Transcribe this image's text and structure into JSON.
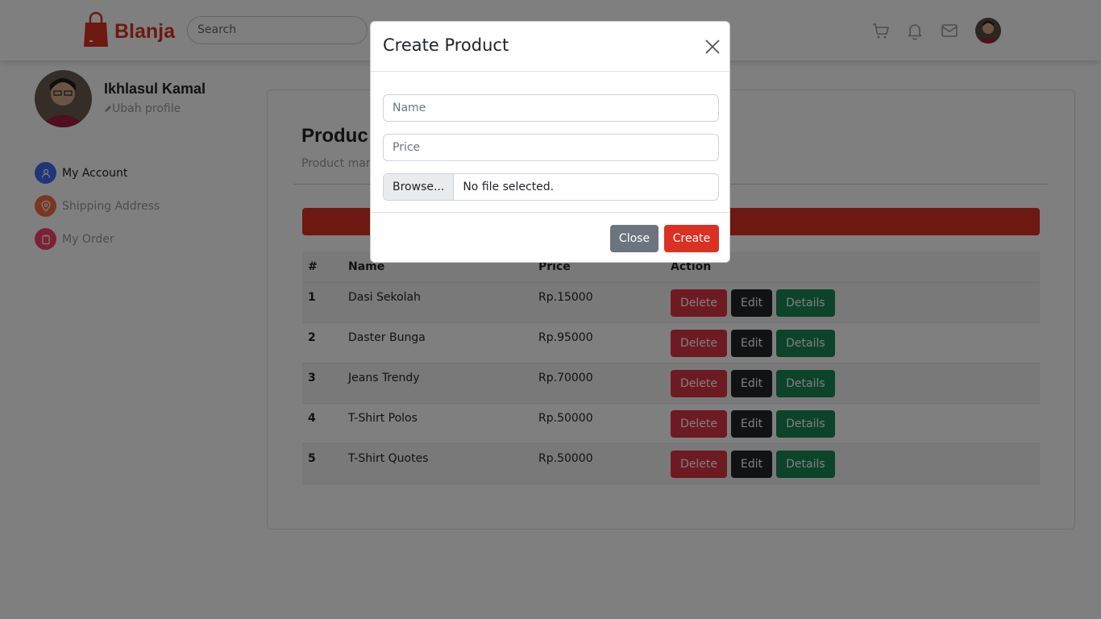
{
  "brand": {
    "name": "Blanja"
  },
  "search": {
    "placeholder": "Search"
  },
  "nav_icons": [
    "cart-icon",
    "bell-icon",
    "mail-icon"
  ],
  "profile": {
    "name": "Ikhlasul Kamal",
    "edit_label": "Ubah profile"
  },
  "sidebar": {
    "items": [
      {
        "label": "My Account",
        "icon": "user-icon",
        "color": "#456bf3"
      },
      {
        "label": "Shipping Address",
        "icon": "map-pin-icon",
        "color": "#f36f45"
      },
      {
        "label": "My Order",
        "icon": "clipboard-icon",
        "color": "#f3456f"
      }
    ]
  },
  "main": {
    "title": "Produc",
    "subtitle": "Product man",
    "table": {
      "headers": [
        "#",
        "Name",
        "Price",
        "Action"
      ],
      "rows": [
        {
          "no": "1",
          "name": "Dasi Sekolah",
          "price": "Rp.15000"
        },
        {
          "no": "2",
          "name": "Daster Bunga",
          "price": "Rp.95000"
        },
        {
          "no": "3",
          "name": "Jeans Trendy",
          "price": "Rp.70000"
        },
        {
          "no": "4",
          "name": "T-Shirt Polos",
          "price": "Rp.50000"
        },
        {
          "no": "5",
          "name": "T-Shirt Quotes",
          "price": "Rp.50000"
        }
      ],
      "actions": {
        "delete": "Delete",
        "edit": "Edit",
        "details": "Details"
      }
    }
  },
  "modal": {
    "title": "Create Product",
    "name_placeholder": "Name",
    "price_placeholder": "Price",
    "file_button": "Browse...",
    "file_status": "No file selected.",
    "close_label": "Close",
    "create_label": "Create"
  },
  "colors": {
    "brand": "#db3022",
    "delete": "#dc3545",
    "edit": "#212529",
    "details": "#198754",
    "close": "#6c757d"
  }
}
